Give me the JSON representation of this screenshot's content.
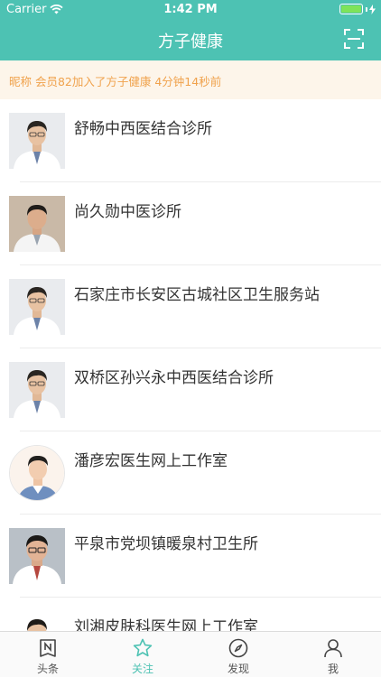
{
  "status_bar": {
    "carrier": "Carrier",
    "time": "1:42 PM"
  },
  "header": {
    "title": "方子健康"
  },
  "notice": {
    "text": "昵称 会员82加入了方子健康  4分钟14秒前"
  },
  "clinics": [
    {
      "name": "舒畅中西医结合诊所"
    },
    {
      "name": "尚久勋中医诊所"
    },
    {
      "name": "石家庄市长安区古城社区卫生服务站"
    },
    {
      "name": "双桥区孙兴永中西医结合诊所"
    },
    {
      "name": "潘彦宏医生网上工作室"
    },
    {
      "name": "平泉市党坝镇暖泉村卫生所"
    },
    {
      "name": "刘湘皮肤科医生网上工作室"
    }
  ],
  "tabbar": {
    "tabs": [
      {
        "label": "头条",
        "icon": "news-icon"
      },
      {
        "label": "关注",
        "icon": "star-icon",
        "active": true
      },
      {
        "label": "发现",
        "icon": "compass-icon"
      },
      {
        "label": "我",
        "icon": "person-icon"
      }
    ]
  },
  "colors": {
    "accent": "#4dc2b3",
    "notice_bg": "#fdf5ea",
    "notice_text": "#f0a24c"
  }
}
